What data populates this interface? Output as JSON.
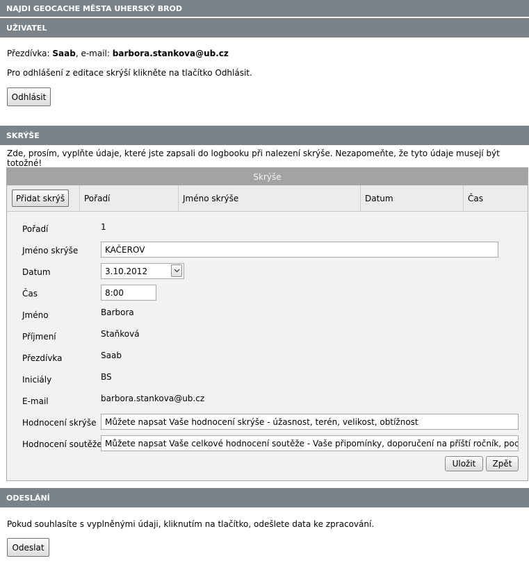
{
  "header": {
    "title": "NAJDI GEOCACHE MĚSTA UHERSKÝ BROD"
  },
  "user": {
    "section_title": "UŽIVATEL",
    "nick_label": "Přezdívka: ",
    "nick": "Saab",
    "email_label": ", e-mail: ",
    "email": "barbora.stankova@ub.cz",
    "logout_text": "Pro odhlášení z editace skrýší klikněte na tlačítko Odhlásit.",
    "logout_button": "Odhlásit"
  },
  "caches": {
    "section_title": "SKRÝŠE",
    "intro": "Zde, prosím, vyplňte údaje, které jste zapsali do logbooku při nalezení skrýše. Nezapomeňte, že tyto údaje musejí být totožné!",
    "grid": {
      "caption": "Skrýše",
      "add_button": "Přidat skrýš",
      "columns": [
        "Pořadí",
        "Jméno skrýše",
        "Datum",
        "Čas"
      ]
    },
    "form": {
      "order_label": "Pořadí",
      "order_value": "1",
      "name_label": "Jméno skrýše",
      "name_value": "KAČEROV",
      "date_label": "Datum",
      "date_value": "3.10.2012",
      "time_label": "Čas",
      "time_value": "8:00",
      "firstname_label": "Jméno",
      "firstname_value": "Barbora",
      "surname_label": "Příjmení",
      "surname_value": "Staňková",
      "nick_label": "Přezdívka",
      "nick_value": "Saab",
      "initials_label": "Iniciály",
      "initials_value": "BS",
      "email_label": "E-mail",
      "email_value": "barbora.stankova@ub.cz",
      "cache_rating_label": "Hodnocení skrýše",
      "cache_rating_value": "Můžete napsat Vaše hodnocení skrýše - úžasnost, terén, velikost, obtížnost",
      "contest_rating_label": "Hodnocení soutěže",
      "contest_rating_value": "Můžete napsat Vaše celkové hodnocení soutěže - Vaše připomínky, doporučení na příští ročník, pochvaly apod.",
      "save_button": "Uložit",
      "back_button": "Zpět"
    }
  },
  "submit": {
    "section_title": "ODESLÁNÍ",
    "text": "Pokud souhlasíte s vyplněnými údaji, kliknutím na tlačítko, odešlete data ke zpracování.",
    "button": "Odeslat"
  }
}
